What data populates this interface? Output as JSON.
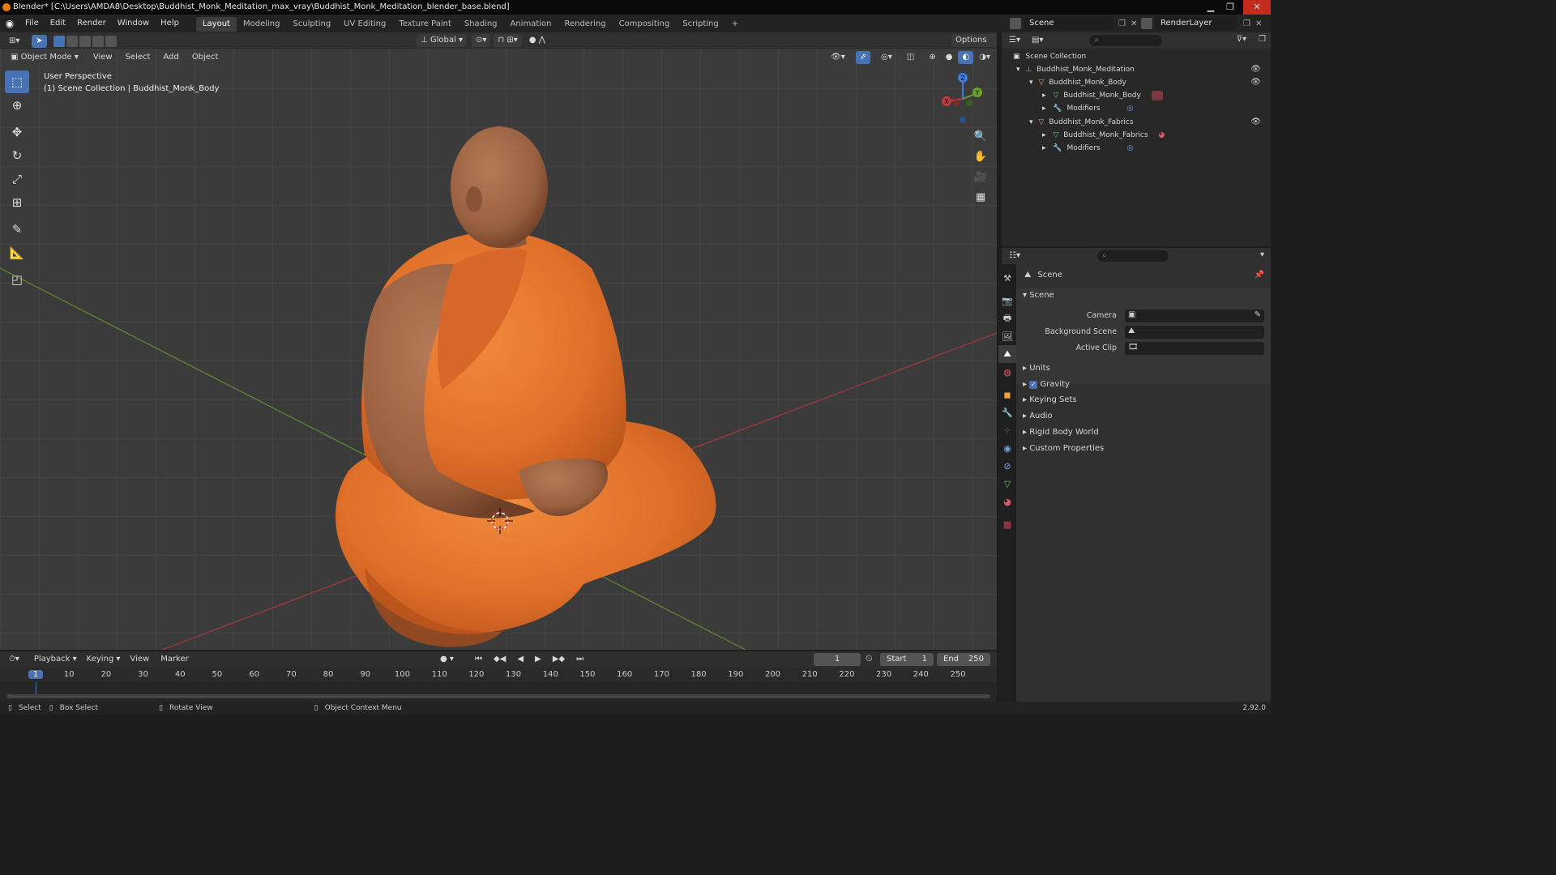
{
  "window": {
    "title": "Blender* [C:\\Users\\AMDA8\\Desktop\\Buddhist_Monk_Meditation_max_vray\\Buddhist_Monk_Meditation_blender_base.blend]"
  },
  "menu": [
    "File",
    "Edit",
    "Render",
    "Window",
    "Help"
  ],
  "workspaces": [
    "Layout",
    "Modeling",
    "Sculpting",
    "UV Editing",
    "Texture Paint",
    "Shading",
    "Animation",
    "Rendering",
    "Compositing",
    "Scripting"
  ],
  "workspace_add": "+",
  "scene_name": "Scene",
  "render_layer": "RenderLayer",
  "viewport": {
    "transform_orientation": "Global",
    "options_label": "Options",
    "mode": "Object Mode",
    "header_menus": [
      "View",
      "Select",
      "Add",
      "Object"
    ],
    "perspective_label": "User Perspective",
    "collection_label": "(1) Scene Collection | Buddhist_Monk_Body",
    "gizmo_axes": {
      "x": "X",
      "y": "Y",
      "z": "Z"
    },
    "colors": {
      "x_axis": "#c0393e",
      "y_axis": "#6aa12b",
      "z_axis": "#3a7ee0",
      "robe": "#e8782f",
      "skin": "#a0684a"
    }
  },
  "timeline": {
    "menus": [
      "Playback",
      "Keying",
      "View",
      "Marker"
    ],
    "current_frame": "1",
    "start_label": "Start",
    "start_value": "1",
    "end_label": "End",
    "end_value": "250",
    "ticks": [
      "1",
      "10",
      "20",
      "30",
      "40",
      "50",
      "60",
      "70",
      "80",
      "90",
      "100",
      "110",
      "120",
      "130",
      "140",
      "150",
      "160",
      "170",
      "180",
      "190",
      "200",
      "210",
      "220",
      "230",
      "240",
      "250"
    ]
  },
  "statusbar": {
    "select": "Select",
    "box_select": "Box Select",
    "rotate_view": "Rotate View",
    "context_menu": "Object Context Menu",
    "version": "2.92.0"
  },
  "outliner": {
    "root": "Scene Collection",
    "items": [
      {
        "label": "Buddhist_Monk_Meditation"
      },
      {
        "label": "Buddhist_Monk_Body"
      },
      {
        "label": "Buddhist_Monk_Body"
      },
      {
        "label": "Modifiers"
      },
      {
        "label": "Buddhist_Monk_Fabrics"
      },
      {
        "label": "Buddhist_Monk_Fabrics"
      },
      {
        "label": "Modifiers"
      }
    ]
  },
  "properties": {
    "context_title": "Scene",
    "panel_title": "Scene",
    "camera_label": "Camera",
    "background_scene_label": "Background Scene",
    "active_clip_label": "Active Clip",
    "panels": [
      "Units",
      "Gravity",
      "Keying Sets",
      "Audio",
      "Rigid Body World",
      "Custom Properties"
    ]
  }
}
